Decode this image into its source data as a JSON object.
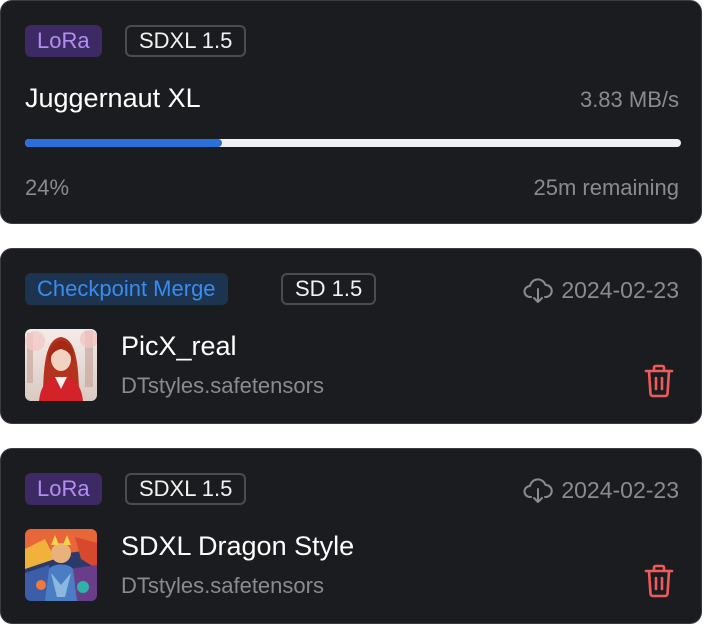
{
  "download": {
    "type_badge": "LoRa",
    "base_badge": "SDXL 1.5",
    "title": "Juggernaut XL",
    "speed": "3.83 MB/s",
    "progress": 0.3,
    "percent_label": "24%",
    "remaining": "25m remaining"
  },
  "models": [
    {
      "type_badge": "Checkpoint Merge",
      "base_badge": "SD 1.5",
      "date": "2024-02-23",
      "name": "PicX_real",
      "file": "DTstyles.safetensors",
      "icon_download": "cloud-download-icon",
      "icon_delete": "trash-icon"
    },
    {
      "type_badge": "LoRa",
      "base_badge": "SDXL 1.5",
      "date": "2024-02-23",
      "name": "SDXL Dragon Style",
      "file": "DTstyles.safetensors",
      "icon_download": "cloud-download-icon",
      "icon_delete": "trash-icon"
    }
  ],
  "colors": {
    "card_bg": "#1b1c20",
    "lora_badge": "#b48cf2",
    "checkpoint_badge": "#3a8bee",
    "progress": "#2b6fd8",
    "delete": "#ef5a5a"
  }
}
